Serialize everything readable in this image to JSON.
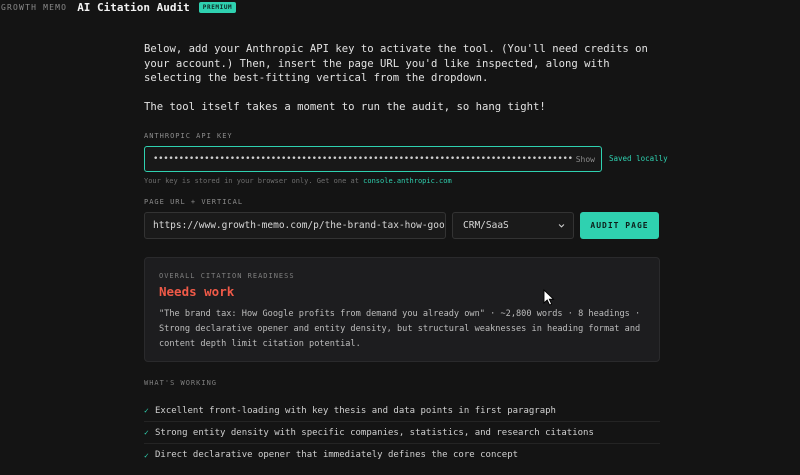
{
  "header": {
    "brand": "GROWTH MEMO",
    "title": "AI Citation Audit",
    "badge": "PREMIUM"
  },
  "intro": {
    "paragraph1": "Below, add your Anthropic API key to activate the tool. (You'll need credits on your account.) Then, insert the page URL you'd like inspected, along with selecting the best-fitting vertical from the dropdown.",
    "paragraph2": "The tool itself takes a moment to run the audit, so hang tight!"
  },
  "api_key": {
    "label": "ANTHROPIC API KEY",
    "value": "••••••••••••••••••••••••••••••••••••••••••••••••••••••••••••••••••••••••••••••••••••••••••••••••",
    "show_label": "Show",
    "saved_label": "Saved locally",
    "hint_prefix": "Your key is stored in your browser only. Get one at",
    "hint_link": "console.anthropic.com"
  },
  "audit": {
    "label": "PAGE URL + VERTICAL",
    "url_value": "https://www.growth-memo.com/p/the-brand-tax-how-google-profits",
    "vertical_selected": "CRM/SaaS",
    "button_label": "AUDIT PAGE"
  },
  "result": {
    "label": "OVERALL CITATION READINESS",
    "status": "Needs work",
    "status_color": "#f05a48",
    "description": "\"The brand tax: How Google profits from demand you already own\" · ~2,800 words · 8 headings · Strong declarative opener and entity density, but structural weaknesses in heading format and content depth limit citation potential."
  },
  "working": {
    "label": "WHAT'S WORKING",
    "items": [
      "Excellent front-loading with key thesis and data points in first paragraph",
      "Strong entity density with specific companies, statistics, and research citations",
      "Direct declarative opener that immediately defines the core concept"
    ]
  },
  "colors": {
    "accent": "#2fd1b0",
    "background": "#141414",
    "card": "#1d1d1f"
  }
}
